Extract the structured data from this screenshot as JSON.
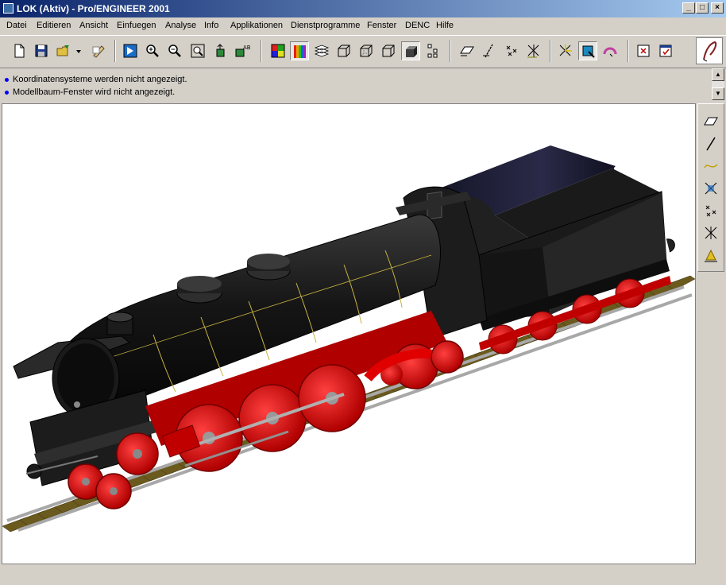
{
  "window": {
    "title": "LOK (Aktiv) - Pro/ENGINEER 2001"
  },
  "menu": [
    "Datei",
    "Editieren",
    "Ansicht",
    "Einfuegen",
    "Analyse",
    "Info",
    "Applikationen",
    "Dienstprogramme",
    "Fenster",
    "DENC",
    "Hilfe"
  ],
  "messages": [
    "Koordinatensysteme werden nicht angezeigt.",
    "Modellbaum-Fenster wird nicht angezeigt."
  ],
  "toolbar_icons": [
    "new-file-icon",
    "save-icon",
    "open-icon",
    "dropdown-arrow-icon",
    "regenerate-icon",
    "repaint-icon",
    "zoom-in-icon",
    "zoom-out-icon",
    "refit-icon",
    "orient-icon",
    "saved-views-icon",
    "color-appearance-icon",
    "shading-icon",
    "layers-icon",
    "wireframe-icon",
    "hidden-line-icon",
    "no-hidden-icon",
    "shaded-icon",
    "model-tree-icon",
    "datum-planes-icon",
    "datum-axes-icon",
    "datum-points-icon",
    "coordinate-systems-icon",
    "spin-center-icon",
    "sketcher-icon",
    "hidden-edges-icon",
    "close-window-icon",
    "activate-window-icon",
    "context-help-icon"
  ],
  "right_toolbar_icons": [
    "datum-plane-icon",
    "datum-axis-icon",
    "datum-curve-icon",
    "datum-point-icon",
    "coordinate-system-icon",
    "analysis-feature-icon",
    "evaluation-icon"
  ],
  "colors": {
    "title_start": "#0a246a",
    "title_end": "#a6caf0",
    "body_black": "#1c1c1c",
    "wheel_red": "#e00000",
    "rail_gray": "#a8a8a8",
    "sleeper_brown": "#6b5a1e"
  }
}
